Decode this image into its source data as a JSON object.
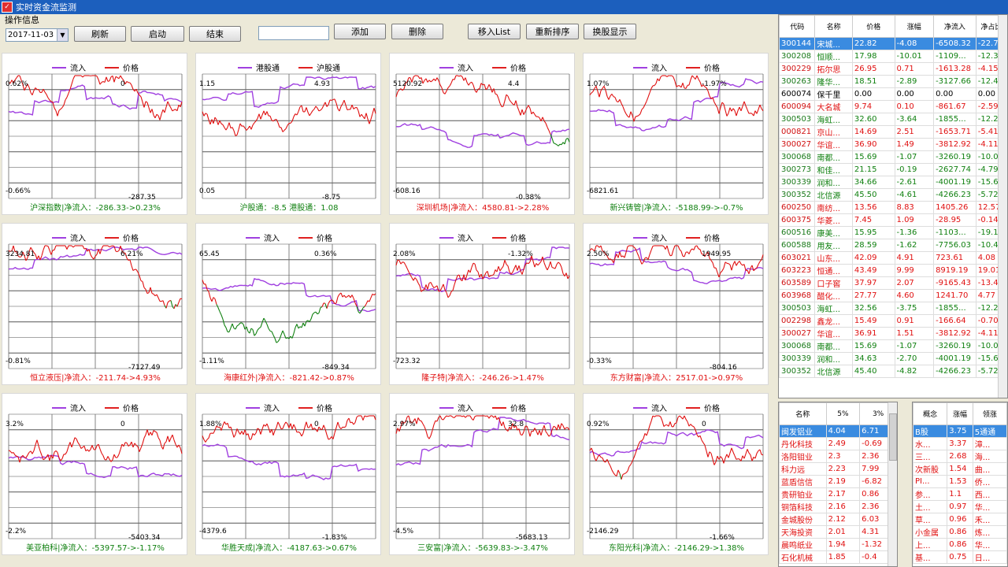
{
  "window": {
    "title": "实时资金流监测",
    "app_icon": "✓"
  },
  "ops_label": "操作信息",
  "toolbar": {
    "date": "2017-11-03",
    "search_value": "",
    "buttons": [
      "刷新",
      "启动",
      "结束",
      "添加",
      "删除",
      "移入List",
      "重新排序",
      "换股显示"
    ]
  },
  "legend_default": {
    "flow": "流入",
    "price": "价格"
  },
  "legend_hk": {
    "a": "港股通",
    "b": "沪股通"
  },
  "colors": {
    "flow": "#a040e0",
    "price": "#e02020",
    "up": "#e01010",
    "down": "#108010"
  },
  "panels": [
    {
      "caption": "沪深指数|净流入：-286.33->0.23%",
      "cap_color": "#108010",
      "labels": [
        "0.62%",
        "0",
        "-0.66%",
        "-287.35"
      ]
    },
    {
      "caption": "沪股通：-8.5  港股通：1.08",
      "cap_color": "#108010",
      "hk": true,
      "labels": [
        "1.15",
        "4.93",
        "0.05",
        "-8.75"
      ]
    },
    {
      "caption": "深圳机场|净流入：4580.81->2.28%",
      "cap_color": "#e01010",
      "labels": [
        "5120.92",
        "4.4",
        "-608.16",
        "-0.38%"
      ]
    },
    {
      "caption": "新兴铸管|净流入：-5188.99->-0.7%",
      "cap_color": "#108010",
      "labels": [
        "1.07%",
        "-1.97%",
        "-6821.61"
      ]
    },
    {
      "caption": "恒立液压|净流入：-211.74->4.93%",
      "cap_color": "#e01010",
      "labels": [
        "3234.81",
        "6.21%",
        "-0.81%",
        "-7127.49"
      ]
    },
    {
      "caption": "海康红外|净流入：-821.42->0.87%",
      "cap_color": "#e01010",
      "labels": [
        "65.45",
        "0.36%",
        "-1.11%",
        "-849.34"
      ]
    },
    {
      "caption": "隆子特|净流入：-246.26->1.47%",
      "cap_color": "#e01010",
      "labels": [
        "2.08%",
        "-1.32%",
        "-723.32"
      ]
    },
    {
      "caption": "东方财富|净流入：2517.01->0.97%",
      "cap_color": "#e01010",
      "labels": [
        "2.50%",
        "1949.95",
        "-0.33%",
        "-804.16"
      ]
    },
    {
      "caption": "美亚柏科|净流入：-5397.57->-1.17%",
      "cap_color": "#108010",
      "labels": [
        "3.2%",
        "0",
        "-2.2%",
        "-5403.34"
      ]
    },
    {
      "caption": "华胜天成|净流入：-4187.63->0.67%",
      "cap_color": "#108010",
      "labels": [
        "1.88%",
        "0",
        "-4379.6",
        "-1.83%"
      ]
    },
    {
      "caption": "三安富|净流入：-5639.83->-3.47%",
      "cap_color": "#108010",
      "labels": [
        "2.97%",
        "32.8",
        "-4.5%",
        "-5683.13"
      ]
    },
    {
      "caption": "东阳光科|净流入：-2146.29->1.38%",
      "cap_color": "#108010",
      "labels": [
        "0.92%",
        "0",
        "-2146.29",
        "-1.66%"
      ]
    }
  ],
  "stock_grid": {
    "headers": [
      "代码",
      "名称",
      "价格",
      "涨幅",
      "净流入",
      "净占比"
    ],
    "rows": [
      {
        "c": "300144",
        "n": "宋城...",
        "p": "22.82",
        "z": "-4.08",
        "j": "-6508.32",
        "b": "-22.79",
        "t": "sel"
      },
      {
        "c": "300208",
        "n": "恒顺...",
        "p": "17.98",
        "z": "-10.01",
        "j": "-1109...",
        "b": "-12.33",
        "t": "g"
      },
      {
        "c": "300229",
        "n": "拓尔思",
        "p": "26.95",
        "z": "0.71",
        "j": "-1613.28",
        "b": "-4.15",
        "t": "r"
      },
      {
        "c": "300263",
        "n": "隆华...",
        "p": "18.51",
        "z": "-2.89",
        "j": "-3127.66",
        "b": "-12.44",
        "t": "g"
      },
      {
        "c": "600074",
        "n": "保千里",
        "p": "0.00",
        "z": "0.00",
        "j": "0.00",
        "b": "0.00",
        "t": "k"
      },
      {
        "c": "600094",
        "n": "大名城",
        "p": "9.74",
        "z": "0.10",
        "j": "-861.67",
        "b": "-2.59",
        "t": "r"
      },
      {
        "c": "300503",
        "n": "海虹...",
        "p": "32.60",
        "z": "-3.64",
        "j": "-1855...",
        "b": "-12.20",
        "t": "g"
      },
      {
        "c": "000821",
        "n": "京山...",
        "p": "14.69",
        "z": "2.51",
        "j": "-1653.71",
        "b": "-5.41",
        "t": "r"
      },
      {
        "c": "300027",
        "n": "华谊...",
        "p": "36.90",
        "z": "1.49",
        "j": "-3812.92",
        "b": "-4.11",
        "t": "r"
      },
      {
        "c": "300068",
        "n": "南都...",
        "p": "15.69",
        "z": "-1.07",
        "j": "-3260.19",
        "b": "-10.09",
        "t": "g"
      },
      {
        "c": "300273",
        "n": "和佳...",
        "p": "21.15",
        "z": "-0.19",
        "j": "-2627.74",
        "b": "-4.79",
        "t": "g"
      },
      {
        "c": "300339",
        "n": "润和...",
        "p": "34.66",
        "z": "-2.61",
        "j": "-4001.19",
        "b": "-15.64",
        "t": "g"
      },
      {
        "c": "300352",
        "n": "北信源",
        "p": "45.50",
        "z": "-4.61",
        "j": "-4266.23",
        "b": "-5.72",
        "t": "g"
      },
      {
        "c": "600250",
        "n": "南纺...",
        "p": "13.56",
        "z": "8.83",
        "j": "1405.26",
        "b": "12.57",
        "t": "r"
      },
      {
        "c": "600375",
        "n": "华菱...",
        "p": "7.45",
        "z": "1.09",
        "j": "-28.95",
        "b": "-0.14",
        "t": "r"
      },
      {
        "c": "600516",
        "n": "康美...",
        "p": "15.95",
        "z": "-1.36",
        "j": "-1103...",
        "b": "-19.14",
        "t": "g"
      },
      {
        "c": "600588",
        "n": "用友...",
        "p": "28.59",
        "z": "-1.62",
        "j": "-7756.03",
        "b": "-10.47",
        "t": "g"
      },
      {
        "c": "603021",
        "n": "山东...",
        "p": "42.09",
        "z": "4.91",
        "j": "723.61",
        "b": "4.08",
        "t": "r"
      },
      {
        "c": "603223",
        "n": "恒通...",
        "p": "43.49",
        "z": "9.99",
        "j": "8919.19",
        "b": "19.01",
        "t": "r"
      },
      {
        "c": "603589",
        "n": "口子窖",
        "p": "37.97",
        "z": "2.07",
        "j": "-9165.43",
        "b": "-13.44",
        "t": "r"
      },
      {
        "c": "603968",
        "n": "醋化...",
        "p": "27.77",
        "z": "4.60",
        "j": "1241.70",
        "b": "4.77",
        "t": "r"
      },
      {
        "c": "300503",
        "n": "海虹...",
        "p": "32.56",
        "z": "-3.75",
        "j": "-1855...",
        "b": "-12.20",
        "t": "g"
      },
      {
        "c": "002298",
        "n": "鑫龙...",
        "p": "15.49",
        "z": "0.91",
        "j": "-166.64",
        "b": "-0.70",
        "t": "r"
      },
      {
        "c": "300027",
        "n": "华谊...",
        "p": "36.91",
        "z": "1.51",
        "j": "-3812.92",
        "b": "-4.11",
        "t": "r"
      },
      {
        "c": "300068",
        "n": "南都...",
        "p": "15.69",
        "z": "-1.07",
        "j": "-3260.19",
        "b": "-10.09",
        "t": "g"
      },
      {
        "c": "300339",
        "n": "润和...",
        "p": "34.63",
        "z": "-2.70",
        "j": "-4001.19",
        "b": "-15.64",
        "t": "g"
      },
      {
        "c": "300352",
        "n": "北信源",
        "p": "45.40",
        "z": "-4.82",
        "j": "-4266.23",
        "b": "-5.72",
        "t": "g"
      }
    ]
  },
  "sector_grid": {
    "headers": [
      "名称",
      "5%",
      "3%"
    ],
    "rows": [
      {
        "n": "闽发铝业",
        "a": "4.04",
        "b": "6.71",
        "t": "sel"
      },
      {
        "n": "丹化科技",
        "a": "2.49",
        "b": "-0.69",
        "t": "r"
      },
      {
        "n": "洛阳钼业",
        "a": "2.3",
        "b": "2.36",
        "t": "r"
      },
      {
        "n": "科力远",
        "a": "2.23",
        "b": "7.99",
        "t": "r"
      },
      {
        "n": "蓝盾信信",
        "a": "2.19",
        "b": "-6.82",
        "t": "r"
      },
      {
        "n": "贵研铂业",
        "a": "2.17",
        "b": "0.86",
        "t": "r"
      },
      {
        "n": "铜箔科技",
        "a": "2.16",
        "b": "2.36",
        "t": "r"
      },
      {
        "n": "金城股份",
        "a": "2.12",
        "b": "6.03",
        "t": "r"
      },
      {
        "n": "天海投资",
        "a": "2.01",
        "b": "4.31",
        "t": "r"
      },
      {
        "n": "晨鸣纸业",
        "a": "1.94",
        "b": "-1.32",
        "t": "r"
      },
      {
        "n": "石化机械",
        "a": "1.85",
        "b": "-0.4",
        "t": "r"
      }
    ]
  },
  "concept_grid": {
    "headers": [
      "概念",
      "涨幅",
      "领涨"
    ],
    "rows": [
      {
        "n": "B股",
        "a": "3.75",
        "b": "5通通",
        "t": "sel"
      },
      {
        "n": "水...",
        "a": "3.37",
        "b": "漳...",
        "t": "r"
      },
      {
        "n": "三...",
        "a": "2.68",
        "b": "海...",
        "t": "r"
      },
      {
        "n": "次新股",
        "a": "1.54",
        "b": "曲...",
        "t": "r"
      },
      {
        "n": "PI...",
        "a": "1.53",
        "b": "侨...",
        "t": "r"
      },
      {
        "n": "参...",
        "a": "1.1",
        "b": "西...",
        "t": "r"
      },
      {
        "n": "土...",
        "a": "0.97",
        "b": "华...",
        "t": "r"
      },
      {
        "n": "草...",
        "a": "0.96",
        "b": "禾...",
        "t": "r"
      },
      {
        "n": "小金属",
        "a": "0.86",
        "b": "炼...",
        "t": "r"
      },
      {
        "n": "上...",
        "a": "0.86",
        "b": "华...",
        "t": "r"
      },
      {
        "n": "基...",
        "a": "0.75",
        "b": "日...",
        "t": "r"
      }
    ]
  }
}
